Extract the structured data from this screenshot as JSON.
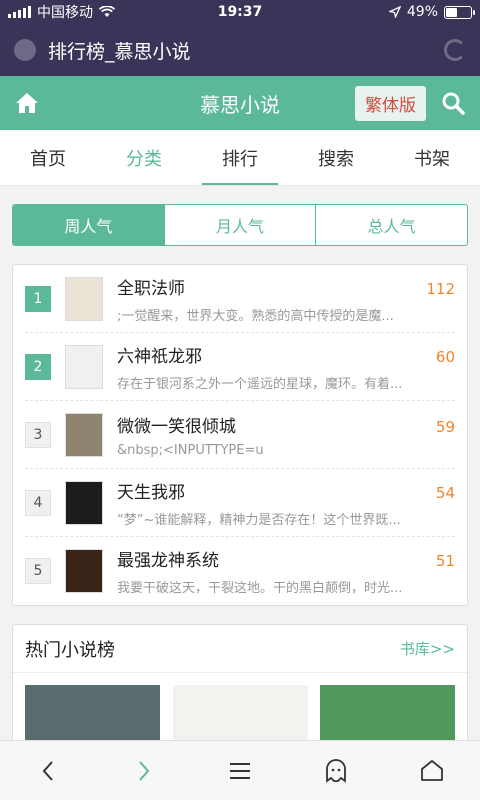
{
  "status": {
    "carrier": "中国移动",
    "time": "19:37",
    "battery": "49%",
    "battery_level": 0.49
  },
  "browser": {
    "title": "排行榜_慕思小说"
  },
  "site": {
    "name": "慕思小说",
    "trad_button": "繁体版"
  },
  "nav": {
    "tabs": [
      "首页",
      "分类",
      "排行",
      "搜索",
      "书架"
    ]
  },
  "segment": {
    "options": [
      "周人气",
      "月人气",
      "总人气"
    ]
  },
  "ranking": [
    {
      "rank": "1",
      "name": "全职法师",
      "score": "112",
      "desc": ";一觉醒来，世界大变。熟悉的高中传授的是魔...",
      "cover": "#e9e4d6"
    },
    {
      "rank": "2",
      "name": "六神祇龙邪",
      "score": "60",
      "desc": "存在于银河系之外一个遥远的星球，魔环。有着...",
      "cover": "#eef0f2"
    },
    {
      "rank": "3",
      "name": "微微一笑很倾城",
      "score": "59",
      "desc": "&nbsp;<INPUTTYPE=u",
      "cover": "#8e8470"
    },
    {
      "rank": "4",
      "name": "天生我邪",
      "score": "54",
      "desc": "“梦”~谁能解释，精神力是否存在！这个世界既...",
      "cover": "#1c1c1c"
    },
    {
      "rank": "5",
      "name": "最强龙神系统",
      "score": "51",
      "desc": "我要干破这天，干裂这地。干的黑白颠倒，时光...",
      "cover": "#3a2418"
    }
  ],
  "hot": {
    "title": "热门小说榜",
    "more": "书库>>",
    "books": [
      {
        "color": "#5a6b70"
      },
      {
        "color": "#f4f2ee"
      },
      {
        "color": "#4f9a5a"
      }
    ]
  }
}
